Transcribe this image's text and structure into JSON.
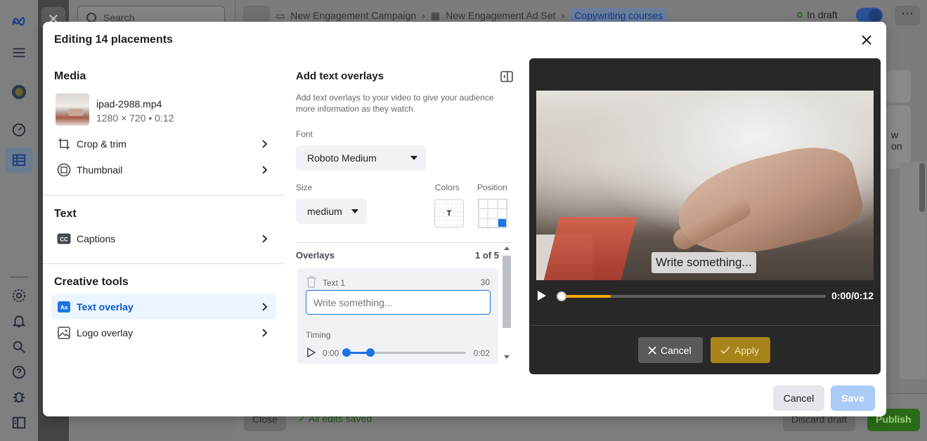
{
  "background": {
    "search_placeholder": "Search",
    "breadcrumb": {
      "campaign": "New Engagement Campaign",
      "ad_set": "New Engagement Ad Set",
      "ad": "Copywriting courses"
    },
    "status": "In draft",
    "footer": {
      "close": "Close",
      "saved": "All edits saved",
      "discard": "Discard draft",
      "publish": "Publish"
    },
    "side_text": "w on"
  },
  "modal": {
    "title": "Editing 14 placements",
    "media": {
      "heading": "Media",
      "file_name": "ipad-2988.mp4",
      "file_meta": "1280 × 720 • 0:12",
      "crop_label": "Crop & trim",
      "thumbnail_label": "Thumbnail"
    },
    "text": {
      "heading": "Text",
      "captions_label": "Captions"
    },
    "creative_tools": {
      "heading": "Creative tools",
      "text_overlay_label": "Text overlay",
      "logo_overlay_label": "Logo overlay"
    },
    "overlay_panel": {
      "title": "Add text overlays",
      "description": "Add text overlays to your video to give your audience more information as they watch.",
      "font_label": "Font",
      "font_value": "Roboto Medium",
      "size_label": "Size",
      "size_value": "medium",
      "colors_label": "Colors",
      "color_swatch_text": "T",
      "position_label": "Position",
      "position_selected_cell": 8,
      "overlays_label": "Overlays",
      "overlays_count": "1 of 5",
      "item": {
        "name": "Text 1",
        "char_limit": "30",
        "placeholder": "Write something...",
        "timing_label": "Timing",
        "start_time": "0:00",
        "end_time": "0:02",
        "range_start_fraction": 0.0,
        "range_end_fraction": 0.2
      }
    },
    "preview": {
      "caption_text": "Write something...",
      "time": "0:00/0:12",
      "buffered_fraction": 0.19,
      "cancel_label": "Cancel",
      "apply_label": "Apply",
      "accent_color": "#f5a600"
    },
    "footer": {
      "cancel_label": "Cancel",
      "save_label": "Save"
    }
  }
}
